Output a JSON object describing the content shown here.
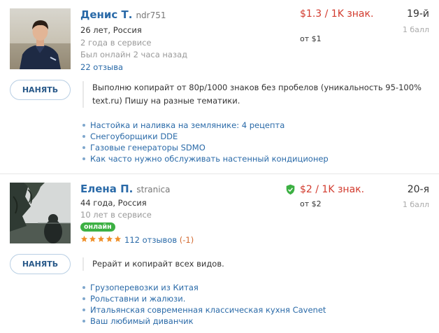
{
  "freelancers": [
    {
      "name": "Денис Т.",
      "username": "ndr751",
      "age_country": "26 лет, Россия",
      "service_time": "2 года в сервисе",
      "last_online": "Был онлайн 2 часа назад",
      "reviews": "22 отзыва",
      "price": "$1.3 / 1K знак.",
      "price_min": "от $1",
      "rank": "19-й",
      "points": "1 балл",
      "hire_label": "НАНЯТЬ",
      "bio": "Выполню копирайт от 80р/1000 знаков без пробелов (уникальность 95-100% text.ru) Пишу на разные тематики.",
      "topics": [
        "Настойка и наливка на землянике: 4 рецепта",
        "Снегоуборщики DDE",
        "Газовые генераторы SDMO",
        "Как часто нужно обслуживать настенный кондиционер"
      ]
    },
    {
      "name": "Елена П.",
      "username": "stranica",
      "age_country": "44 года, Россия",
      "service_time": "10 лет в сервисе",
      "online_badge": "онлайн",
      "rating_stars": 5,
      "reviews": "112 отзывов",
      "reviews_delta": "(-1)",
      "price": "$2 / 1K знак.",
      "price_min": "от $2",
      "rank": "20-я",
      "points": "1 балл",
      "hire_label": "НАНЯТЬ",
      "bio": "Рерайт и копирайт всех видов.",
      "topics": [
        "Грузоперевозки из Китая",
        "Рольставни и жалюзи.",
        "Итальянская современная классическая кухня Cavenet",
        "Ваш любимый диванчик"
      ]
    }
  ],
  "colors": {
    "link": "#2a6aa8",
    "price": "#d23b2e",
    "online": "#3cb043",
    "star": "#f0902a",
    "verified": "#3cb043"
  },
  "icons": {
    "verified": "shield-check-icon",
    "star": "star-icon"
  }
}
